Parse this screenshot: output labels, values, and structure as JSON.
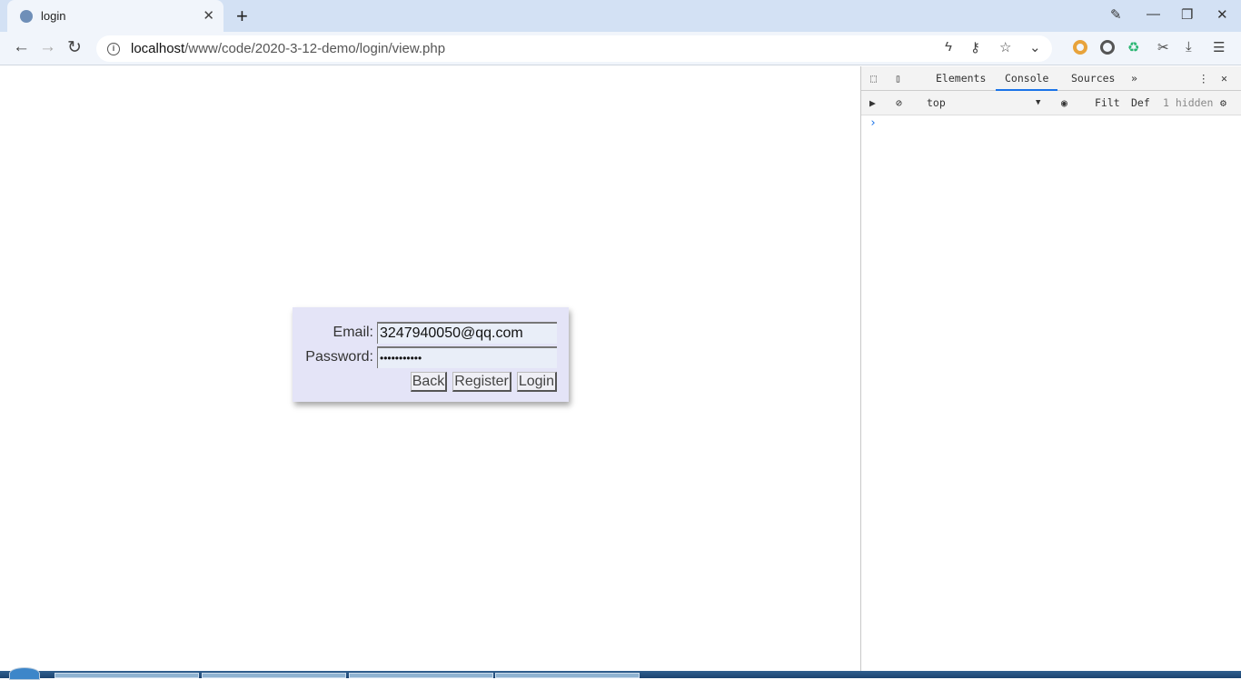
{
  "browser": {
    "tab_title": "login",
    "new_tab": "+",
    "close_tab": "✕",
    "url_host": "localhost",
    "url_path": "/www/code/2020-3-12-demo/login/view.php"
  },
  "form": {
    "email_label": "Email:",
    "email_value": "3247940050@qq.com",
    "password_label": "Password:",
    "password_value": "•••••••••••",
    "back": "Back",
    "register": "Register",
    "login": "Login"
  },
  "devtools": {
    "tabs": [
      "Elements",
      "Console",
      "Sources"
    ],
    "more": "»",
    "active_tab": "Console",
    "context": "top",
    "filter": "Filt",
    "levels": "Def",
    "hidden": "1 hidden",
    "prompt": "›",
    "accent": "#1a73e8"
  }
}
